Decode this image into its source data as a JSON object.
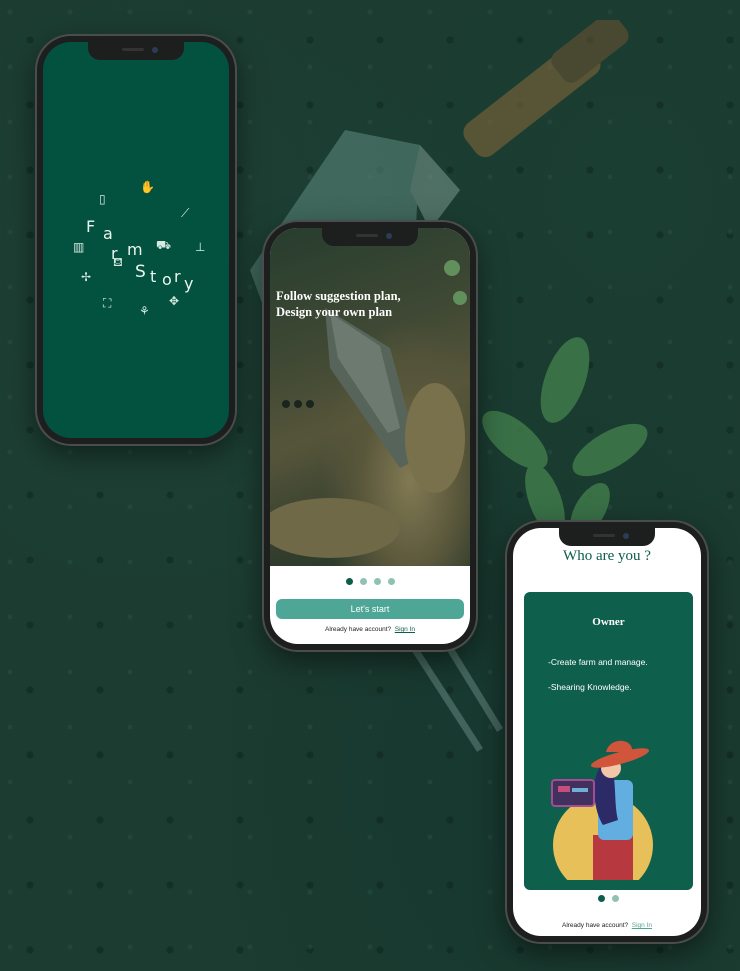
{
  "splash": {
    "logo_letters": [
      "F",
      "a",
      "r",
      "m",
      "S",
      "t",
      "o",
      "r",
      "y"
    ],
    "icons": [
      "seed-bag-icon",
      "gloves-icon",
      "trowel-icon",
      "fence-icon",
      "watering-can-icon",
      "plant-icon",
      "scarecrow-icon",
      "rake-icon",
      "wheelbarrow-icon",
      "lawnmower-icon",
      "windmill-icon"
    ]
  },
  "onboarding": {
    "headline_line1": "Follow suggestion plan,",
    "headline_line2": "Design your own plan",
    "pages": 4,
    "active_page": 0,
    "start_button": "Let's start",
    "already_text": "Already have account?",
    "sign_in": "Sign In"
  },
  "role_select": {
    "title": "Who are you ?",
    "card_title": "Owner",
    "bullet1": "-Create farm and manage.",
    "bullet2": "-Shearing Knowledge.",
    "pages": 2,
    "active_page": 0,
    "already_text": "Already have account?",
    "sign_in": "Sign In"
  },
  "colors": {
    "brand_green": "#02523f",
    "accent_teal": "#4ea796",
    "background": "#1c3b31"
  }
}
